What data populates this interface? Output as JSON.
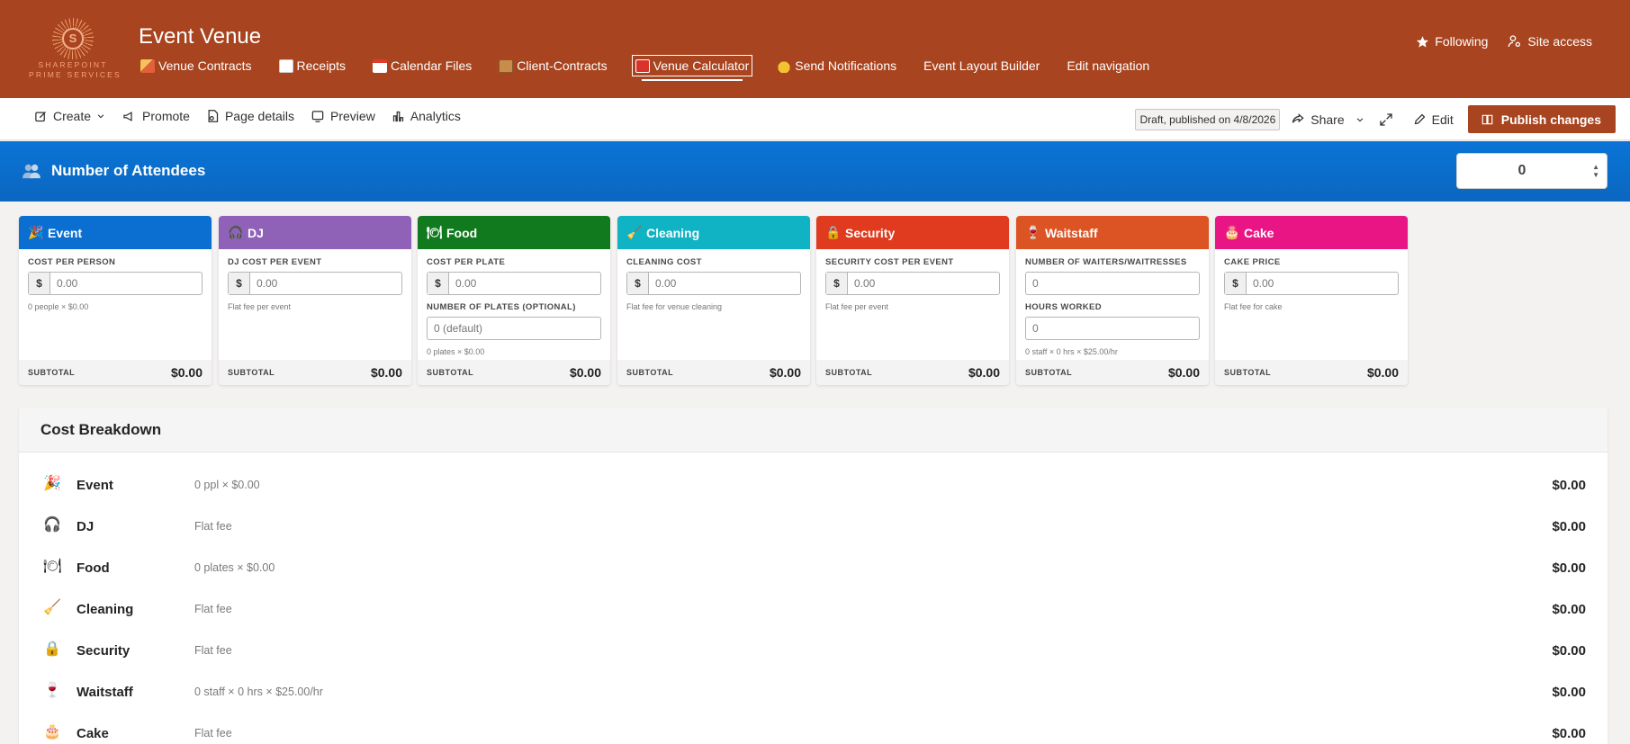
{
  "site": {
    "logo_letter": "S",
    "logo_line1": "SHAREPOINT",
    "logo_line2": "PRIME SERVICES",
    "title": "Event Venue",
    "nav": [
      {
        "label": "Venue Contracts",
        "icon": "party-icon"
      },
      {
        "label": "Receipts",
        "icon": "receipt-icon"
      },
      {
        "label": "Calendar Files",
        "icon": "calendar-icon"
      },
      {
        "label": "Client-Contracts",
        "icon": "cabinet-icon"
      },
      {
        "label": "Venue Calculator",
        "icon": "abacus-icon",
        "active": true
      },
      {
        "label": "Send Notifications",
        "icon": "bell-icon"
      },
      {
        "label": "Event Layout Builder"
      },
      {
        "label": "Edit navigation"
      }
    ],
    "following_label": "Following",
    "site_access_label": "Site access"
  },
  "commandbar": {
    "create": "Create",
    "promote": "Promote",
    "page_details": "Page details",
    "preview": "Preview",
    "analytics": "Analytics",
    "status": "Draft, published on 4/8/2026",
    "share": "Share",
    "edit": "Edit",
    "publish": "Publish changes"
  },
  "attendees": {
    "label": "Number of Attendees",
    "value": "0",
    "color": "#0a6fd0"
  },
  "cards": [
    {
      "title": "Event",
      "emoji": "🎉",
      "color": "#0a6fd0",
      "field1_label": "Cost per person",
      "field1_value": "0.00",
      "note": "0 people × $0.00",
      "subtotal_label": "SUBTOTAL",
      "subtotal": "$0.00"
    },
    {
      "title": "DJ",
      "emoji": "🎧",
      "color": "#8f62b8",
      "field1_label": "DJ cost per event",
      "field1_value": "0.00",
      "note": "Flat fee per event",
      "subtotal_label": "SUBTOTAL",
      "subtotal": "$0.00"
    },
    {
      "title": "Food",
      "emoji": "🍽",
      "color": "#117a1f",
      "field1_label": "Cost per plate",
      "field1_value": "0.00",
      "field2_label": "Number of plates (optional)",
      "field2_placeholder": "0 (default)",
      "note": "0 plates × $0.00",
      "subtotal_label": "SUBTOTAL",
      "subtotal": "$0.00"
    },
    {
      "title": "Cleaning",
      "emoji": "🧹",
      "color": "#10b3c4",
      "field1_label": "Cleaning cost",
      "field1_value": "0.00",
      "note": "Flat fee for venue cleaning",
      "subtotal_label": "SUBTOTAL",
      "subtotal": "$0.00"
    },
    {
      "title": "Security",
      "emoji": "🔒",
      "color": "#e03a1f",
      "field1_label": "Security cost per event",
      "field1_value": "0.00",
      "note": "Flat fee per event",
      "subtotal_label": "SUBTOTAL",
      "subtotal": "$0.00"
    },
    {
      "title": "Waitstaff",
      "emoji": "🍷",
      "color": "#dc5423",
      "field1_label": "Number of waiters/waitresses",
      "field1_value": "0",
      "field2_label": "Hours worked",
      "field2_value": "0",
      "note": "0 staff × 0 hrs × $25.00/hr",
      "subtotal_label": "SUBTOTAL",
      "subtotal": "$0.00"
    },
    {
      "title": "Cake",
      "emoji": "🎂",
      "color": "#ea1585",
      "field1_label": "Cake price",
      "field1_value": "0.00",
      "note": "Flat fee for cake",
      "subtotal_label": "SUBTOTAL",
      "subtotal": "$0.00"
    }
  ],
  "breakdown": {
    "title": "Cost Breakdown",
    "rows": [
      {
        "emoji": "🎉",
        "name": "Event",
        "detail": "0 ppl × $0.00",
        "amount": "$0.00"
      },
      {
        "emoji": "🎧",
        "name": "DJ",
        "detail": "Flat fee",
        "amount": "$0.00"
      },
      {
        "emoji": "🍽",
        "name": "Food",
        "detail": "0 plates × $0.00",
        "amount": "$0.00"
      },
      {
        "emoji": "🧹",
        "name": "Cleaning",
        "detail": "Flat fee",
        "amount": "$0.00"
      },
      {
        "emoji": "🔒",
        "name": "Security",
        "detail": "Flat fee",
        "amount": "$0.00"
      },
      {
        "emoji": "🍷",
        "name": "Waitstaff",
        "detail": "0 staff × 0 hrs × $25.00/hr",
        "amount": "$0.00"
      },
      {
        "emoji": "🎂",
        "name": "Cake",
        "detail": "Flat fee",
        "amount": "$0.00"
      }
    ]
  }
}
